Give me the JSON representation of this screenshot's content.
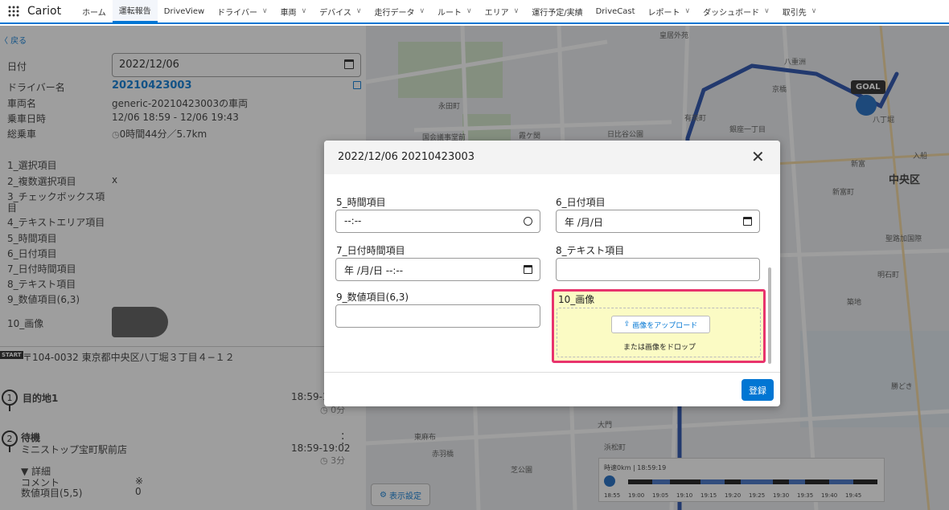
{
  "topnav": {
    "brand": "Cariot",
    "items": [
      {
        "label": "ホーム",
        "chevron": false,
        "active": false
      },
      {
        "label": "運転報告",
        "chevron": false,
        "active": true
      },
      {
        "label": "DriveView",
        "chevron": false,
        "active": false
      },
      {
        "label": "ドライバー",
        "chevron": true,
        "active": false
      },
      {
        "label": "車両",
        "chevron": true,
        "active": false
      },
      {
        "label": "デバイス",
        "chevron": true,
        "active": false
      },
      {
        "label": "走行データ",
        "chevron": true,
        "active": false
      },
      {
        "label": "ルート",
        "chevron": true,
        "active": false
      },
      {
        "label": "エリア",
        "chevron": true,
        "active": false
      },
      {
        "label": "運行予定/実績",
        "chevron": false,
        "active": false
      },
      {
        "label": "DriveCast",
        "chevron": false,
        "active": false
      },
      {
        "label": "レポート",
        "chevron": true,
        "active": false
      },
      {
        "label": "ダッシュボード",
        "chevron": true,
        "active": false
      },
      {
        "label": "取引先",
        "chevron": true,
        "active": false
      }
    ]
  },
  "left": {
    "back": "〈 戻る",
    "date_label": "日付",
    "date_value": "2022/12/06",
    "driver_label": "ドライバー名",
    "driver_value": "20210423003",
    "vehicle_label": "車両名",
    "vehicle_value": "generic-20210423003の車両",
    "ride_label": "乗車日時",
    "ride_value": "12/06 18:59 - 12/06 19:43",
    "total_label": "総乗車",
    "total_value": "0時間44分／5.7km",
    "fields": [
      {
        "label": "1_選択項目",
        "value": ""
      },
      {
        "label": "2_複数選択項目",
        "value": "x"
      },
      {
        "label": "3_チェックボックス項",
        "value": ""
      },
      {
        "label": "目",
        "value": ""
      },
      {
        "label": "4_テキストエリア項目",
        "value": ""
      },
      {
        "label": "5_時間項目",
        "value": ""
      },
      {
        "label": "6_日付項目",
        "value": ""
      },
      {
        "label": "7_日付時間項目",
        "value": ""
      },
      {
        "label": "8_テキスト項目",
        "value": ""
      },
      {
        "label": "9_数値項目(6,3)",
        "value": ""
      }
    ],
    "image_label": "10_画像",
    "start_badge": "START",
    "start_address": "〒104-0032 東京都中央区八丁堀３丁目４−１２",
    "stop1_num": "1",
    "stop1_name": "目的地1",
    "stop1_time": "18:59-1",
    "stop1_dur": "0分",
    "stop2_num": "2",
    "stop2_name": "待機",
    "stop2_place": "ミニストップ宝町駅前店",
    "stop2_time": "18:59-19:02",
    "stop2_dur": "3分",
    "detail_toggle": "▼ 詳細",
    "comment_label": "コメント",
    "comment_value": "※",
    "num_label": "数値項目(5,5)",
    "num_value": "0"
  },
  "map": {
    "labels": [
      "皇居外苑",
      "永田町",
      "日比谷公園",
      "霞ケ関",
      "国会議事堂前",
      "八重洲",
      "京橋",
      "有楽町",
      "銀座一丁目",
      "新富",
      "入船",
      "中央区",
      "聖路加国際",
      "明石町",
      "築地",
      "勝どき",
      "東麻布",
      "赤羽橋",
      "芝公園",
      "浜松町",
      "大門",
      "八丁堀",
      "新富町"
    ],
    "goal": "GOAL",
    "display_settings": "表示設定",
    "timeline_head": "時速0km  |  18:59:19",
    "ticks": [
      "18:55",
      "19:00",
      "19:05",
      "19:10",
      "19:15",
      "19:20",
      "19:25",
      "19:30",
      "19:35",
      "19:40",
      "19:45"
    ]
  },
  "modal": {
    "title": "2022/12/06 20210423003",
    "close": "✕",
    "f5_label": "5_時間項目",
    "f5_value": "--:--",
    "f6_label": "6_日付項目",
    "f6_value": "年 /月/日",
    "f7_label": "7_日付時間項目",
    "f7_value": "年 /月/日 --:--",
    "f8_label": "8_テキスト項目",
    "f8_value": "",
    "f9_label": "9_数値項目(6,3)",
    "f9_value": "",
    "f10_label": "10_画像",
    "upload_label": "画像をアップロード",
    "drop_text": "または画像をドロップ",
    "submit": "登録"
  }
}
